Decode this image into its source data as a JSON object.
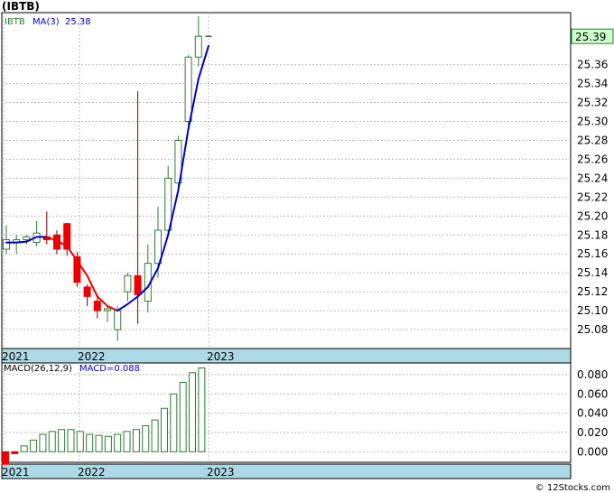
{
  "title": "(IBTB)",
  "footer": "© 12Stocks.com",
  "colors": {
    "background": "#ffffff",
    "grid": "#bbbbbb",
    "axis_band": "#add8e6",
    "up_candle": "#2e7d32",
    "down_candle": "#ee0000",
    "ma_up": "#0000cc",
    "ma_down": "#ee0000",
    "macd_bar": "#2e7d32",
    "macd_neg": "#ee0000",
    "label_blue": "#0000cc"
  },
  "chart_data": [
    {
      "type": "candlestick",
      "legend": {
        "symbol": "IBTB",
        "ma_label": "MA(3)",
        "ma_value": "25.38"
      },
      "last_price_label": "25.39",
      "ylim": [
        25.06,
        25.415
      ],
      "y_ticks": [
        "25.08",
        "25.10",
        "25.12",
        "25.14",
        "25.16",
        "25.18",
        "25.20",
        "25.22",
        "25.24",
        "25.26",
        "25.28",
        "25.30",
        "25.32",
        "25.34",
        "25.36"
      ],
      "x_labels": [
        "2021",
        "2022",
        "2023"
      ],
      "candles": [
        {
          "o": 25.165,
          "h": 25.19,
          "l": 25.16,
          "c": 25.175
        },
        {
          "o": 25.172,
          "h": 25.18,
          "l": 25.16,
          "c": 25.175
        },
        {
          "o": 25.175,
          "h": 25.18,
          "l": 25.17,
          "c": 25.178
        },
        {
          "o": 25.172,
          "h": 25.195,
          "l": 25.168,
          "c": 25.182
        },
        {
          "o": 25.178,
          "h": 25.205,
          "l": 25.17,
          "c": 25.175
        },
        {
          "o": 25.18,
          "h": 25.185,
          "l": 25.16,
          "c": 25.165
        },
        {
          "o": 25.192,
          "h": 25.193,
          "l": 25.158,
          "c": 25.165
        },
        {
          "o": 25.157,
          "h": 25.162,
          "l": 25.125,
          "c": 25.13
        },
        {
          "o": 25.125,
          "h": 25.128,
          "l": 25.105,
          "c": 25.115
        },
        {
          "o": 25.11,
          "h": 25.116,
          "l": 25.092,
          "c": 25.1
        },
        {
          "o": 25.1,
          "h": 25.106,
          "l": 25.088,
          "c": 25.102
        },
        {
          "o": 25.08,
          "h": 25.105,
          "l": 25.068,
          "c": 25.1
        },
        {
          "o": 25.12,
          "h": 25.14,
          "l": 25.11,
          "c": 25.137
        },
        {
          "o": 25.137,
          "h": 25.332,
          "l": 25.086,
          "c": 25.117
        },
        {
          "o": 25.11,
          "h": 25.17,
          "l": 25.098,
          "c": 25.15
        },
        {
          "o": 25.15,
          "h": 25.21,
          "l": 25.135,
          "c": 25.185
        },
        {
          "o": 25.185,
          "h": 25.253,
          "l": 25.18,
          "c": 25.24
        },
        {
          "o": 25.235,
          "h": 25.285,
          "l": 25.225,
          "c": 25.28
        },
        {
          "o": 25.3,
          "h": 25.37,
          "l": 25.29,
          "c": 25.368
        },
        {
          "o": 25.368,
          "h": 25.411,
          "l": 25.358,
          "c": 25.39
        },
        {
          "o": 25.39,
          "h": 25.39,
          "l": 25.39,
          "c": 25.39
        }
      ],
      "ma": [
        25.172,
        25.172,
        25.173,
        25.178,
        25.178,
        25.174,
        25.168,
        25.153,
        25.137,
        25.115,
        25.105,
        25.1,
        25.107,
        25.115,
        25.125,
        25.145,
        25.18,
        25.227,
        25.292,
        25.345,
        25.38
      ]
    },
    {
      "type": "bar",
      "legend": {
        "label": "MACD(26,12,9)",
        "value_label": "MACD=0.088"
      },
      "ylim": [
        -0.011,
        0.094
      ],
      "y_ticks": [
        "0.000",
        "0.020",
        "0.040",
        "0.060",
        "0.080"
      ],
      "x_labels": [
        "2021",
        "2022",
        "2023"
      ],
      "values": [
        -0.013,
        -0.002,
        0.006,
        0.012,
        0.018,
        0.021,
        0.023,
        0.023,
        0.021,
        0.018,
        0.017,
        0.016,
        0.018,
        0.021,
        0.023,
        0.027,
        0.033,
        0.045,
        0.06,
        0.072,
        0.082,
        0.087
      ]
    }
  ]
}
